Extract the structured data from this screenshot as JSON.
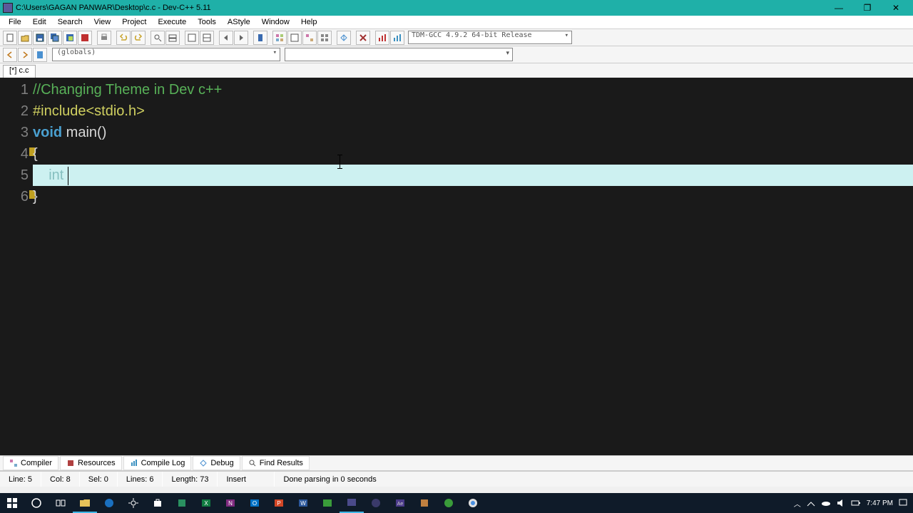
{
  "window": {
    "title": "C:\\Users\\GAGAN PANWAR\\Desktop\\c.c - Dev-C++ 5.11"
  },
  "menu": [
    "File",
    "Edit",
    "Search",
    "View",
    "Project",
    "Execute",
    "Tools",
    "AStyle",
    "Window",
    "Help"
  ],
  "compiler_combo": "TDM-GCC 4.9.2 64-bit Release",
  "scope_combo": "(globals)",
  "tab": "[*] c.c",
  "editor": {
    "gutter": [
      "1",
      "2",
      "3",
      "4",
      "5",
      "6"
    ],
    "line1": "//Changing Theme in Dev c++",
    "line2": "#include<stdio.h>",
    "line3_type": "void",
    "line3_func": " main()",
    "line4": "{",
    "line5_indent": "    ",
    "line5_kw": "int ",
    "line6": "}"
  },
  "bottom_tabs": {
    "compiler": "Compiler",
    "resources": "Resources",
    "compile_log": "Compile Log",
    "debug": "Debug",
    "find_results": "Find Results"
  },
  "status": {
    "line": "Line:   5",
    "col": "Col:   8",
    "sel": "Sel:   0",
    "lines": "Lines:   6",
    "length": "Length:   73",
    "mode": "Insert",
    "msg": "Done parsing in 0 seconds"
  },
  "taskbar": {
    "time": "7:47 PM"
  }
}
